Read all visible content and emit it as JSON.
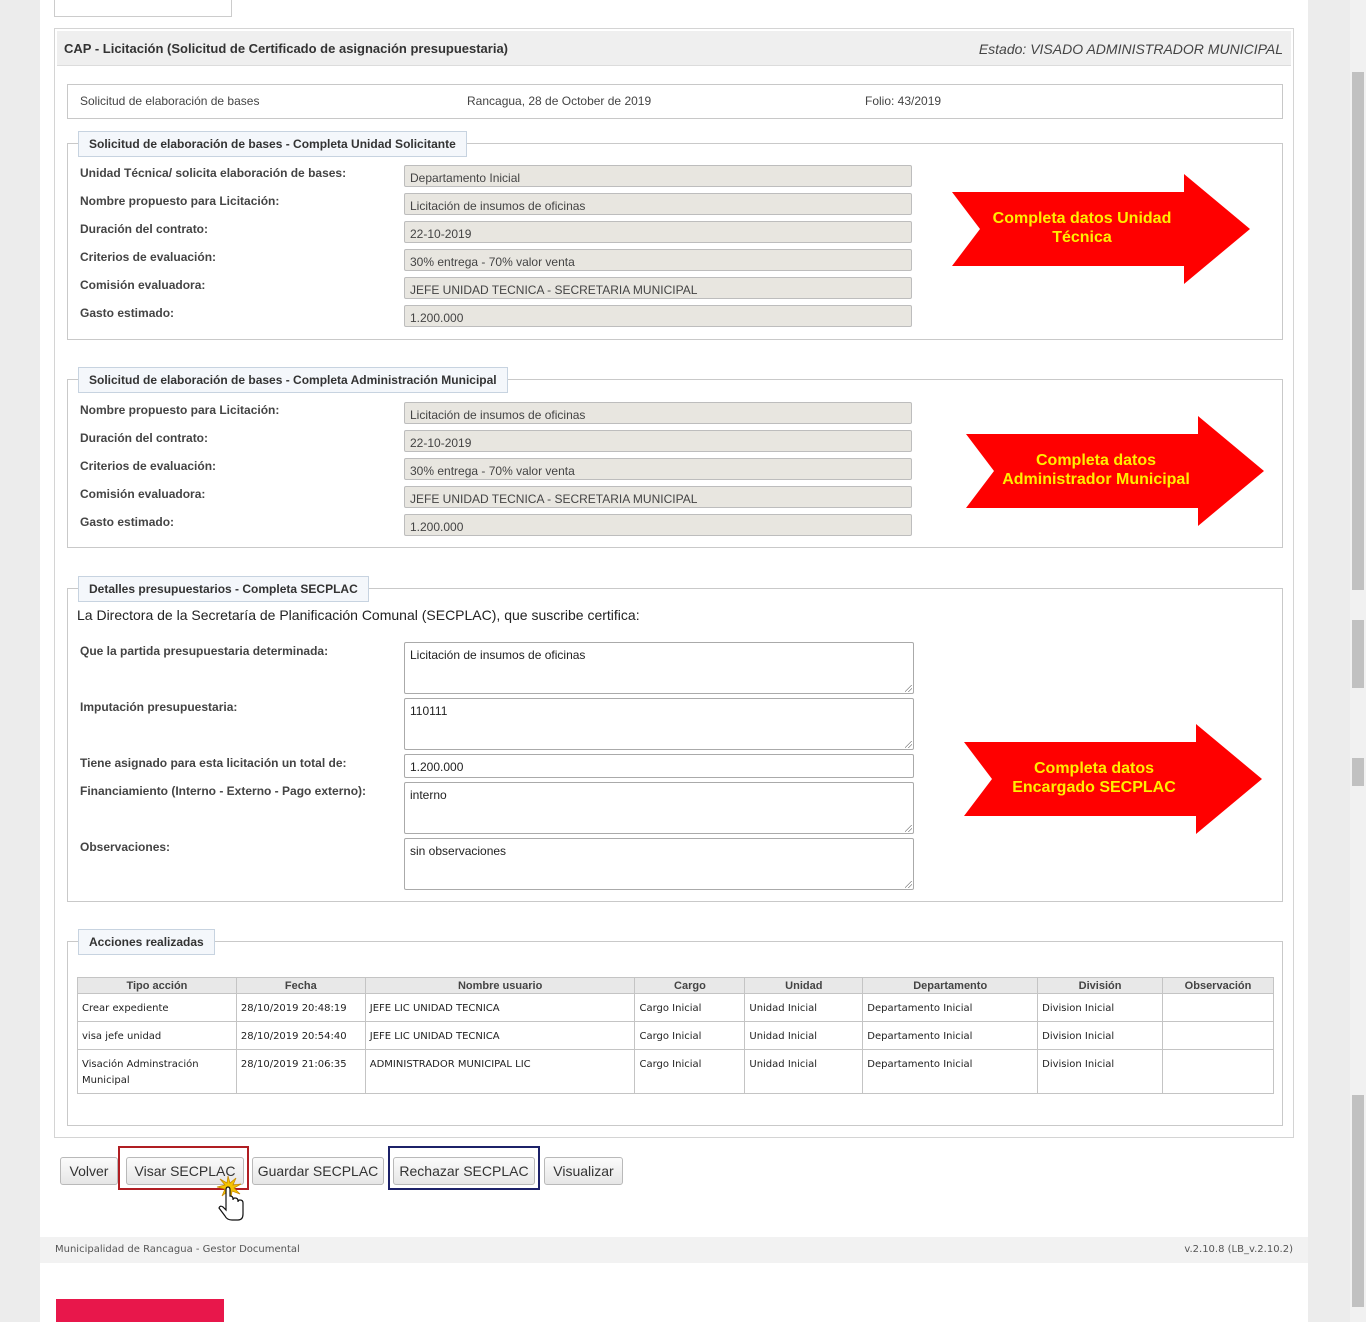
{
  "panel": {
    "title": "CAP - Licitación (Solicitud de Certificado de asignación presupuestaria)",
    "status": "Estado: VISADO ADMINISTRADOR MUNICIPAL"
  },
  "meta": {
    "request": "Solicitud de elaboración de bases",
    "place_date": "Rancagua, 28 de October de 2019",
    "folio": "Folio: 43/2019"
  },
  "section1": {
    "legend": "Solicitud de elaboración de bases - Completa Unidad Solicitante",
    "fields": [
      {
        "label": "Unidad Técnica/ solicita elaboración de bases:",
        "value": "Departamento Inicial"
      },
      {
        "label": "Nombre propuesto para Licitación:",
        "value": "Licitación de insumos de oficinas"
      },
      {
        "label": "Duración del contrato:",
        "value": "22-10-2019"
      },
      {
        "label": "Criterios de evaluación:",
        "value": "30% entrega - 70% valor venta"
      },
      {
        "label": "Comisión evaluadora:",
        "value": "JEFE UNIDAD TECNICA - SECRETARIA MUNICIPAL"
      },
      {
        "label": "Gasto estimado:",
        "value": "1.200.000"
      }
    ],
    "arrow_text": "Completa datos Unidad Técnica"
  },
  "section2": {
    "legend": "Solicitud de elaboración de bases - Completa Administración Municipal",
    "fields": [
      {
        "label": "Nombre propuesto para Licitación:",
        "value": "Licitación de insumos de oficinas"
      },
      {
        "label": "Duración del contrato:",
        "value": "22-10-2019"
      },
      {
        "label": "Criterios de evaluación:",
        "value": "30% entrega - 70% valor venta"
      },
      {
        "label": "Comisión evaluadora:",
        "value": "JEFE UNIDAD TECNICA - SECRETARIA MUNICIPAL"
      },
      {
        "label": "Gasto estimado:",
        "value": "1.200.000"
      }
    ],
    "arrow_text": "Completa datos Administrador Municipal"
  },
  "section3": {
    "legend": "Detalles presupuestarios - Completa SECPLAC",
    "certify_text": "La Directora de la Secretaría de Planificación Comunal (SECPLAC), que suscribe certifica:",
    "fields": [
      {
        "label": "Que la partida presupuestaria determinada:",
        "value": "Licitación de insumos de oficinas"
      },
      {
        "label": "Imputación presupuestaria:",
        "value": "110111"
      },
      {
        "label": "Tiene asignado para esta licitación un total de:",
        "value": "1.200.000"
      },
      {
        "label": "Financiamiento (Interno - Externo - Pago externo):",
        "value": "interno"
      },
      {
        "label": "Observaciones:",
        "value": "sin observaciones"
      }
    ],
    "arrow_text": "Completa datos Encargado SECPLAC"
  },
  "actions": {
    "legend": "Acciones realizadas",
    "headers": [
      "Tipo acción",
      "Fecha",
      "Nombre usuario",
      "Cargo",
      "Unidad",
      "Departamento",
      "División",
      "Observación"
    ],
    "rows": [
      [
        "Crear expediente",
        "28/10/2019 20:48:19",
        "JEFE LIC UNIDAD TECNICA",
        "Cargo Inicial",
        "Unidad Inicial",
        "Departamento Inicial",
        "Division Inicial",
        ""
      ],
      [
        "visa jefe unidad",
        "28/10/2019 20:54:40",
        "JEFE LIC UNIDAD TECNICA",
        "Cargo Inicial",
        "Unidad Inicial",
        "Departamento Inicial",
        "Division Inicial",
        ""
      ],
      [
        "Visación Adminstración Municipal",
        "28/10/2019 21:06:35",
        "ADMINISTRADOR MUNICIPAL LIC",
        "Cargo Inicial",
        "Unidad Inicial",
        "Departamento Inicial",
        "Division Inicial",
        ""
      ]
    ]
  },
  "buttons": {
    "back": "Volver",
    "approve": "Visar SECPLAC",
    "save": "Guardar SECPLAC",
    "reject": "Rechazar SECPLAC",
    "view": "Visualizar"
  },
  "footer": {
    "left": "Municipalidad de Rancagua - Gestor Documental",
    "right": "v.2.10.8 (LB_v.2.10.2)"
  },
  "colors": {
    "arrow_fill": "#ff0000",
    "arrow_text": "#ffee00",
    "highlight_red": "#b01e23",
    "highlight_blue": "#1c2168",
    "brand_bar": "#e8174b"
  },
  "icons": {
    "cursor": "hand-pointer-icon"
  }
}
